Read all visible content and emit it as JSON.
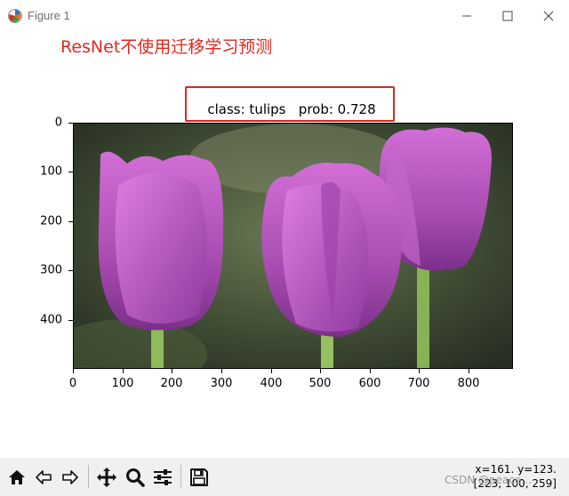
{
  "window": {
    "title": "Figure 1",
    "minimize_glyph": "—",
    "maximize_glyph": "☐",
    "close_glyph": "✕"
  },
  "annotation": {
    "text": "ResNet不使用迁移学习预测",
    "color": "#e0281e"
  },
  "plot": {
    "title": "class: tulips   prob: 0.728",
    "xticks": [
      "0",
      "100",
      "200",
      "300",
      "400",
      "500",
      "600",
      "700",
      "800"
    ],
    "yticks": [
      "0",
      "100",
      "200",
      "300",
      "400"
    ],
    "image_description_icon": "tulip-photo"
  },
  "toolbar": {
    "buttons": [
      "home-icon",
      "back-icon",
      "forward-icon",
      "pan-icon",
      "zoom-icon",
      "configure-subplots-icon",
      "save-icon"
    ]
  },
  "status": {
    "coords": "x=161. y=123.",
    "pixel": "[223, 100, 259]"
  },
  "watermark": "CSDN @peace..."
}
